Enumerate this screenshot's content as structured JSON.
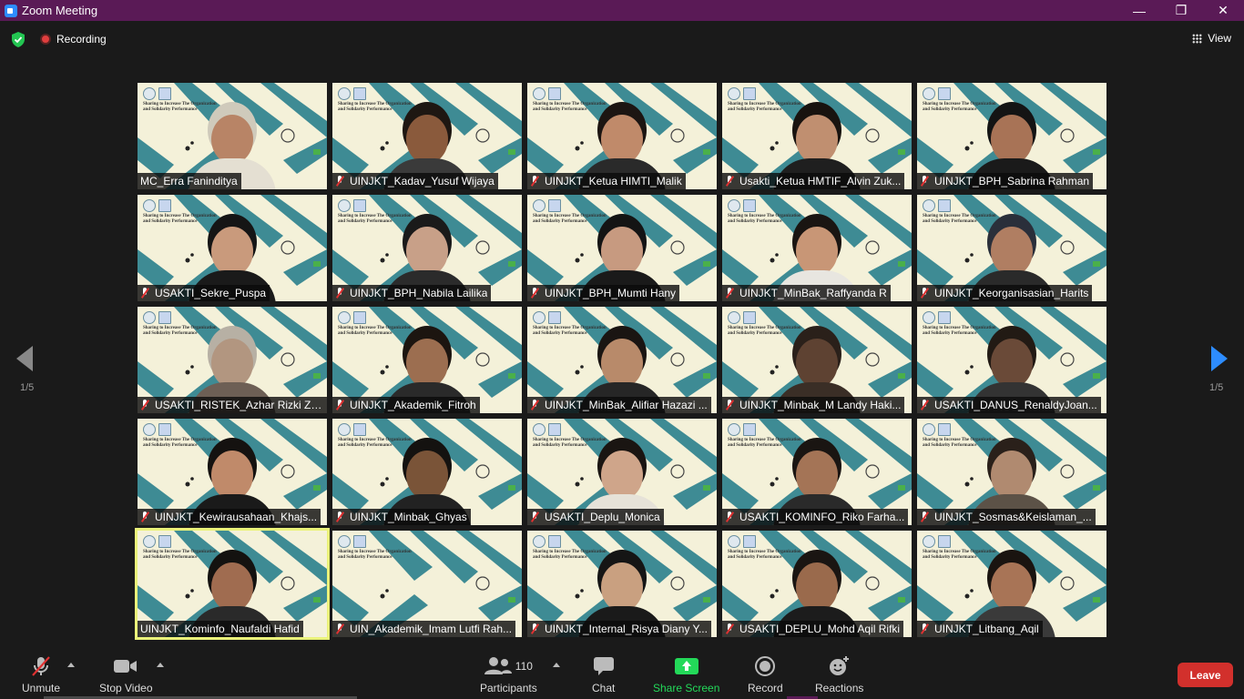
{
  "window": {
    "title": "Zoom Meeting",
    "minimize": "—",
    "restore": "❐",
    "close": "✕"
  },
  "status": {
    "recording_label": "Recording",
    "view_label": "View"
  },
  "pager": {
    "left": "1/5",
    "right": "1/5"
  },
  "slide": {
    "line1": "Sharing to Increase The Organization",
    "line2": "and Solidarity Performance"
  },
  "participants_grid": [
    {
      "name": "MC_Erra Faninditya",
      "muted": false,
      "skin": "#b88466",
      "top": "#cfcabb",
      "shirt": "#e4dfd2"
    },
    {
      "name": "UINJKT_Kadav_Yusuf Wijaya",
      "muted": true,
      "skin": "#8a5a3c",
      "top": "#1e1712",
      "shirt": "#3a3a3a"
    },
    {
      "name": "UINJKT_Ketua HIMTI_Malik",
      "muted": true,
      "skin": "#c08a6a",
      "top": "#1c1512",
      "shirt": "#2a2a2a"
    },
    {
      "name": "Usakti_Ketua HMTIF_Alvin Zuk...",
      "muted": true,
      "skin": "#c08f70",
      "top": "#18130f",
      "shirt": "#1f1f1f"
    },
    {
      "name": "UINJKT_BPH_Sabrina Rahman",
      "muted": true,
      "skin": "#a87356",
      "top": "#141414",
      "shirt": "#1a1a1a"
    },
    {
      "name": "USAKTI_Sekre_Puspa",
      "muted": true,
      "skin": "#c99a7c",
      "top": "#151515",
      "shirt": "#1a1a1a"
    },
    {
      "name": "UINJKT_BPH_Nabila Lailika",
      "muted": true,
      "skin": "#c8a088",
      "top": "#1a1a1a",
      "shirt": "#2b2b2b"
    },
    {
      "name": "UINJKT_BPH_Mumti Hany",
      "muted": true,
      "skin": "#c79a80",
      "top": "#141414",
      "shirt": "#1a1a1a"
    },
    {
      "name": "UINJKT_MinBak_Raffyanda R",
      "muted": true,
      "skin": "#c89676",
      "top": "#1a1512",
      "shirt": "#e8e6e0"
    },
    {
      "name": "UINJKT_Keorganisasian_Harits",
      "muted": true,
      "skin": "#b07e62",
      "top": "#2a2f3a",
      "shirt": "#2a2a2a"
    },
    {
      "name": "USAKTI_RISTEK_Azhar Rizki Zu...",
      "muted": true,
      "skin": "#b29680",
      "top": "#b7b0a4",
      "shirt": "#6d5f55"
    },
    {
      "name": "UINJKT_Akademik_Fitroh",
      "muted": true,
      "skin": "#9c6e50",
      "top": "#1c1510",
      "shirt": "#2a2a2a"
    },
    {
      "name": "UINJKT_MinBak_Alifiar Hazazi ...",
      "muted": true,
      "skin": "#b88a6a",
      "top": "#1a1512",
      "shirt": "#262626"
    },
    {
      "name": "UINJKT_Minbak_M Landy Haki...",
      "muted": true,
      "skin": "#5e4232",
      "top": "#2a201a",
      "shirt": "#3a2e26"
    },
    {
      "name": "USAKTI_DANUS_RenaldyJoan...",
      "muted": true,
      "skin": "#6a4a38",
      "top": "#221a14",
      "shirt": "#333"
    },
    {
      "name": "UINJKT_Kewirausahaan_Khajs...",
      "muted": true,
      "skin": "#c08a6a",
      "top": "#151210",
      "shirt": "#1a1a1a"
    },
    {
      "name": "UINJKT_Minbak_Ghyas",
      "muted": true,
      "skin": "#7a5438",
      "top": "#141210",
      "shirt": "#222"
    },
    {
      "name": "USAKTI_Deplu_Monica",
      "muted": true,
      "skin": "#cfa58a",
      "top": "#1a1512",
      "shirt": "#e6e2d8"
    },
    {
      "name": "USAKTI_KOMINFO_Riko Farha...",
      "muted": true,
      "skin": "#a47456",
      "top": "#1a1512",
      "shirt": "#2a2a2a"
    },
    {
      "name": "UINJKT_Sosmas&Keislaman_...",
      "muted": true,
      "skin": "#b08a70",
      "top": "#2a201a",
      "shirt": "#5c5247"
    },
    {
      "name": "UINJKT_Kominfo_Naufaldi Hafid",
      "muted": false,
      "skin": "#a06c50",
      "top": "#141210",
      "shirt": "#2a2a2a",
      "active": true
    },
    {
      "name": "UIN_Akademik_Imam Lutfi Rah...",
      "muted": true,
      "skin": "",
      "top": "",
      "shirt": ""
    },
    {
      "name": "UINJKT_Internal_Risya Diany Y...",
      "muted": true,
      "skin": "#c9a080",
      "top": "#151515",
      "shirt": "#1a1a1a"
    },
    {
      "name": "USAKTI_DEPLU_Mohd Aqil Rifki",
      "muted": true,
      "skin": "#9a6a4c",
      "top": "#1a1512",
      "shirt": "#1c1c1c"
    },
    {
      "name": "UINJKT_Litbang_Aqil",
      "muted": true,
      "skin": "#a87456",
      "top": "#1a1410",
      "shirt": "#3a3a3a"
    }
  ],
  "toolbar": {
    "unmute": "Unmute",
    "stop_video": "Stop Video",
    "participants": "Participants",
    "participants_count": "110",
    "chat": "Chat",
    "share_screen": "Share Screen",
    "record": "Record",
    "reactions": "Reactions",
    "leave": "Leave"
  },
  "colors": {
    "titlebar": "#5a1a56",
    "share_green": "#23d959",
    "leave_red": "#d2302c",
    "accent_blue": "#2d8cff"
  }
}
